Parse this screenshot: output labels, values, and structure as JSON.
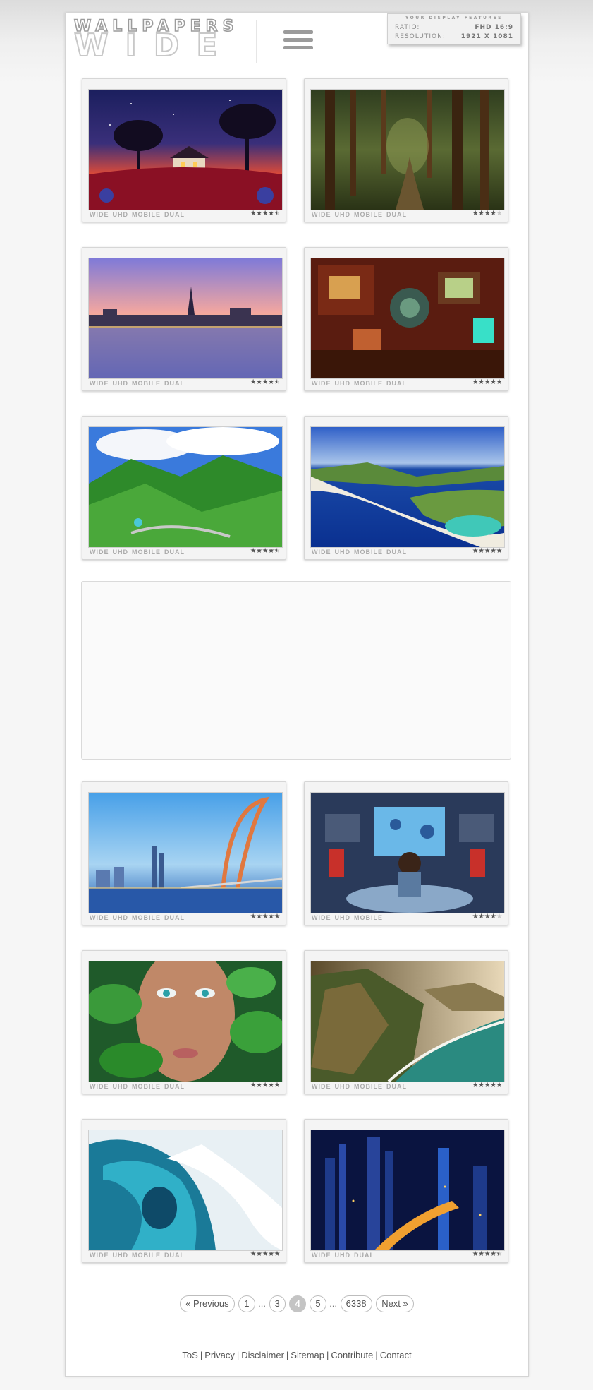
{
  "header": {
    "logo_top": "WALLPAPERS",
    "logo_bottom": "WIDE",
    "display_features": {
      "title": "YOUR DISPLAY FEATURES",
      "ratio_label": "RATIO:",
      "ratio_value": "FHD 16:9",
      "resolution_label": "RESOLUTION:",
      "resolution_value": "1921 X 1081"
    }
  },
  "wallpapers": [
    {
      "id": "cottage-night",
      "tags": [
        "WIDE",
        "UHD",
        "MOBILE",
        "DUAL"
      ],
      "rating": 4.5
    },
    {
      "id": "forest-path",
      "tags": [
        "WIDE",
        "UHD",
        "MOBILE",
        "DUAL"
      ],
      "rating": 4
    },
    {
      "id": "city-waterfront-sunset",
      "tags": [
        "WIDE",
        "UHD",
        "MOBILE",
        "DUAL"
      ],
      "rating": 4.5
    },
    {
      "id": "retro-computer-room",
      "tags": [
        "WIDE",
        "UHD",
        "MOBILE",
        "DUAL"
      ],
      "rating": 5
    },
    {
      "id": "green-mountain-valley",
      "tags": [
        "WIDE",
        "UHD",
        "MOBILE",
        "DUAL"
      ],
      "rating": 4.5
    },
    {
      "id": "coastal-cliffs",
      "tags": [
        "WIDE",
        "UHD",
        "MOBILE",
        "DUAL"
      ],
      "rating": 5
    },
    {
      "id": "arch-bridge-city",
      "tags": [
        "WIDE",
        "UHD",
        "MOBILE",
        "DUAL"
      ],
      "rating": 5
    },
    {
      "id": "gamer-room",
      "tags": [
        "WIDE",
        "UHD",
        "MOBILE"
      ],
      "rating": 4
    },
    {
      "id": "woman-leaves",
      "tags": [
        "WIDE",
        "UHD",
        "MOBILE",
        "DUAL"
      ],
      "rating": 5
    },
    {
      "id": "ridge-coast",
      "tags": [
        "WIDE",
        "UHD",
        "MOBILE",
        "DUAL"
      ],
      "rating": 5
    },
    {
      "id": "ocean-wave",
      "tags": [
        "WIDE",
        "UHD",
        "MOBILE",
        "DUAL"
      ],
      "rating": 5
    },
    {
      "id": "night-city-skyline",
      "tags": [
        "WIDE",
        "UHD",
        "DUAL"
      ],
      "rating": 4.5
    }
  ],
  "pagination": {
    "previous": "« Previous",
    "pages": [
      "1",
      "...",
      "3",
      "4",
      "5",
      "...",
      "6338"
    ],
    "active": "4",
    "next": "Next »"
  },
  "footer": {
    "links": [
      "ToS",
      "Privacy",
      "Disclaimer",
      "Sitemap",
      "Contribute",
      "Contact"
    ]
  }
}
